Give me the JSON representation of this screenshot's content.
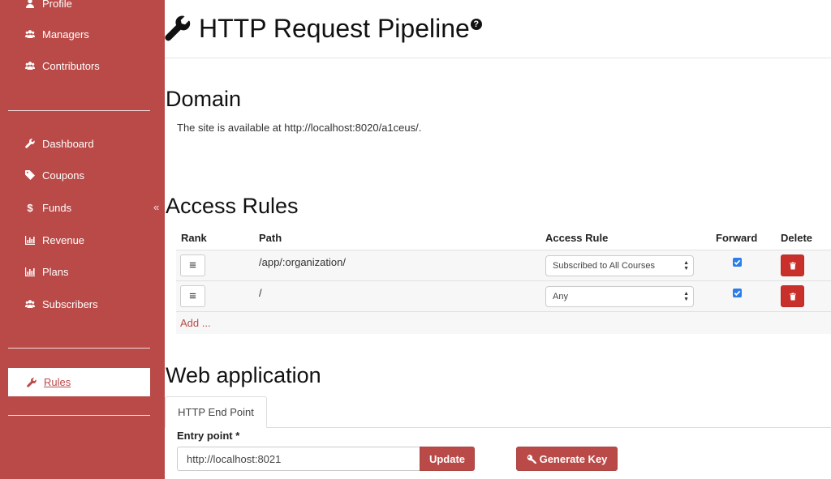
{
  "sidebar": {
    "items_top": [
      {
        "label": "Profile",
        "icon": "user-icon"
      },
      {
        "label": "Managers",
        "icon": "users-icon"
      },
      {
        "label": "Contributors",
        "icon": "users-icon"
      }
    ],
    "items_mid": [
      {
        "label": "Dashboard",
        "icon": "wrench-icon"
      },
      {
        "label": "Coupons",
        "icon": "tag-icon"
      },
      {
        "label": "Funds",
        "icon": "dollar-icon"
      },
      {
        "label": "Revenue",
        "icon": "bar-chart-icon"
      },
      {
        "label": "Plans",
        "icon": "bar-chart-icon"
      },
      {
        "label": "Subscribers",
        "icon": "users-icon"
      }
    ],
    "collapse_glyph": "«",
    "active_item": {
      "label": "Rules",
      "icon": "wrench-icon"
    }
  },
  "header": {
    "title": "HTTP Request Pipeline",
    "help_glyph": "?"
  },
  "domain": {
    "heading": "Domain",
    "text": "The site is available at http://localhost:8020/a1ceus/."
  },
  "access_rules": {
    "heading": "Access Rules",
    "columns": {
      "rank": "Rank",
      "path": "Path",
      "rule": "Access Rule",
      "forward": "Forward",
      "delete": "Delete"
    },
    "rows": [
      {
        "rank_glyph": "≡",
        "path": "/app/:organization/",
        "rule": "Subscribed to All Courses",
        "forward": true
      },
      {
        "rank_glyph": "≡",
        "path": "/",
        "rule": "Any",
        "forward": true
      }
    ],
    "add_label": "Add ..."
  },
  "web_app": {
    "heading": "Web application",
    "tab_label": "HTTP End Point",
    "entry_label": "Entry point *",
    "entry_value": "http://localhost:8021",
    "update_label": "Update",
    "generate_label": "Generate Key"
  },
  "colors": {
    "brand": "#b94a48",
    "danger": "#c9302c",
    "check": "#2b7de9"
  }
}
